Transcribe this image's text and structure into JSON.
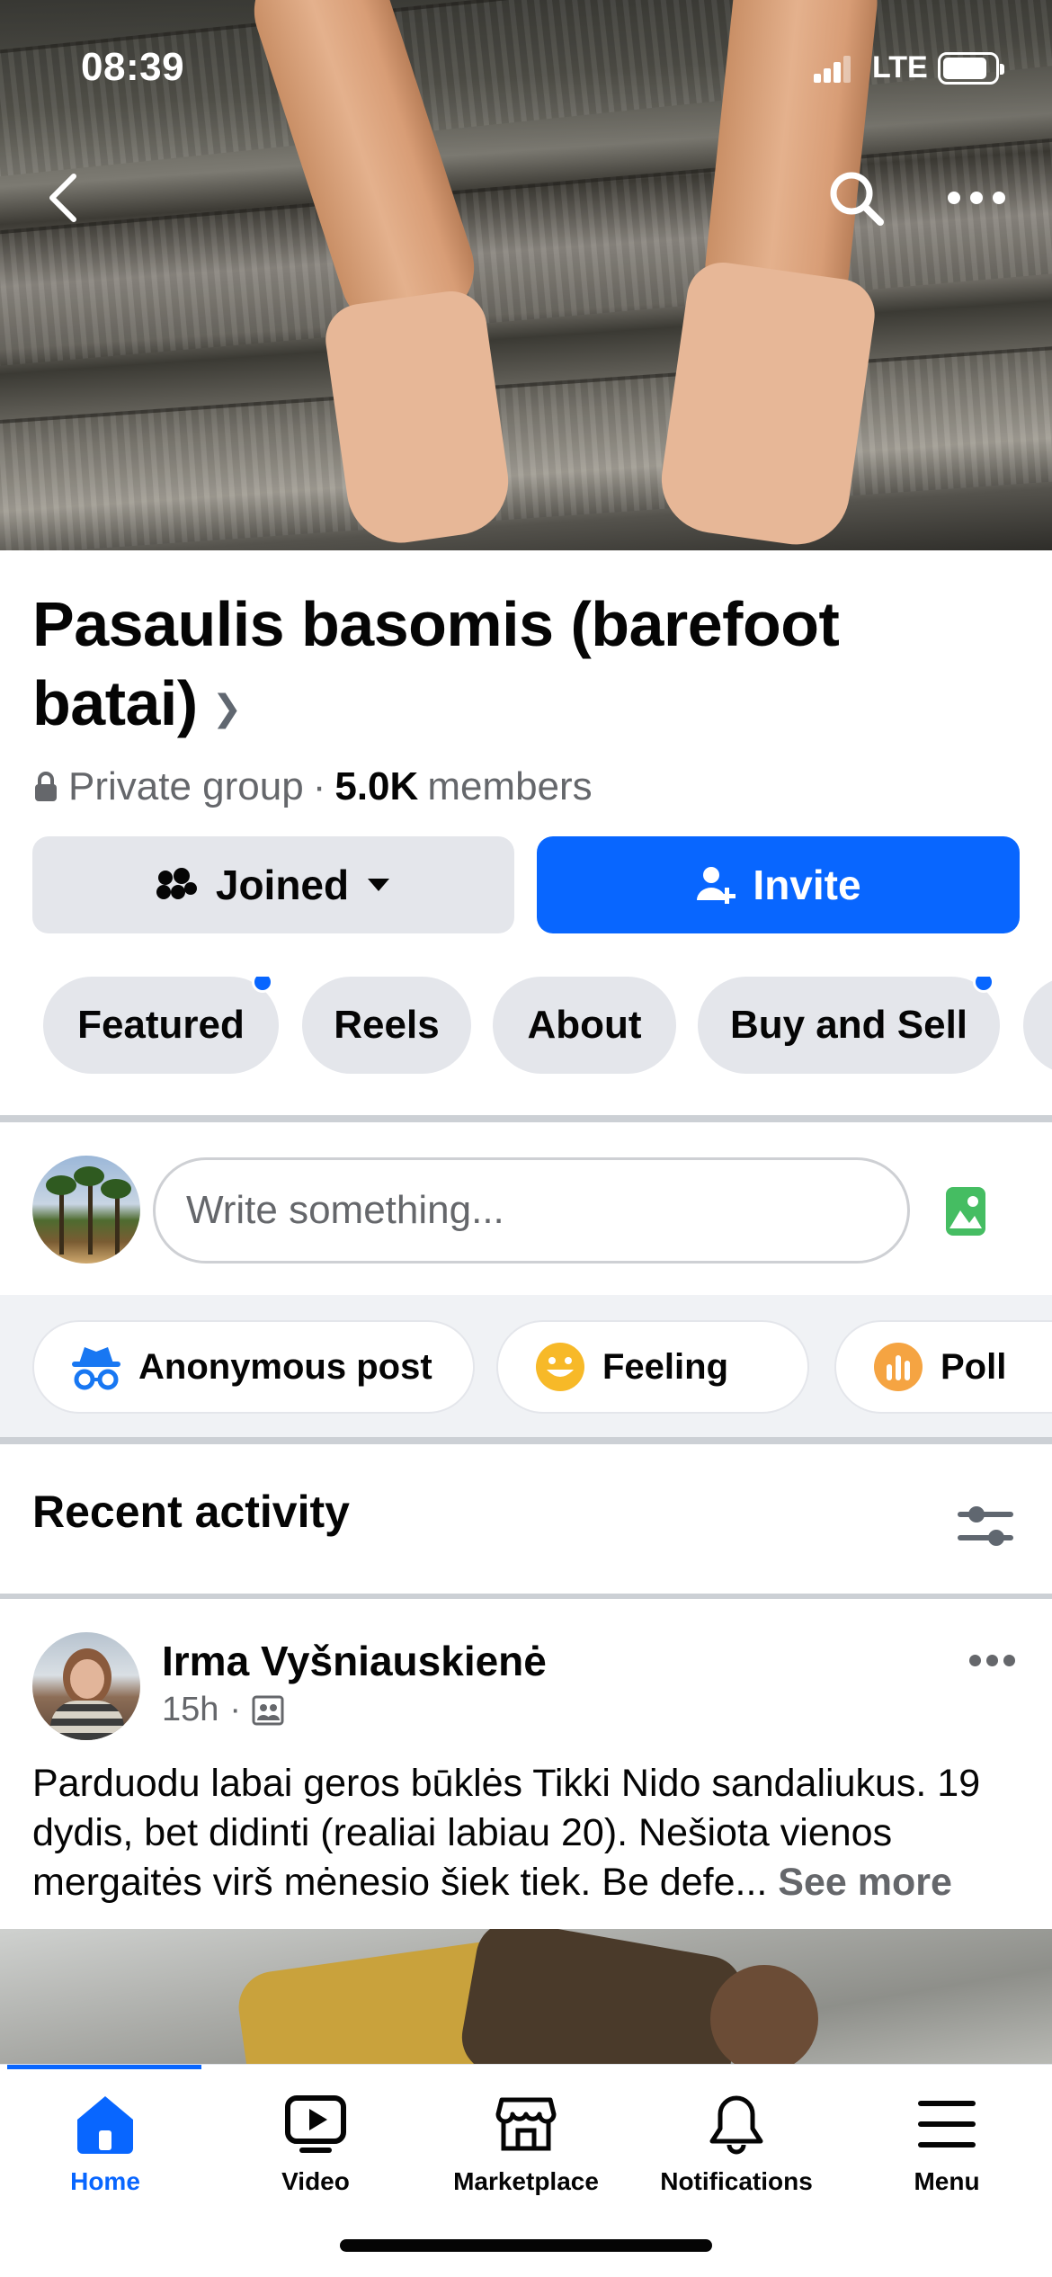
{
  "status_bar": {
    "time": "08:39",
    "network": "LTE"
  },
  "group": {
    "name": "Pasaulis basomis (barefoot batai)",
    "privacy": "Private group",
    "separator": "·",
    "members_count": "5.0K",
    "members_label": "members",
    "joined_label": "Joined",
    "invite_label": "Invite"
  },
  "tabs": [
    {
      "label": "Featured",
      "has_dot": true
    },
    {
      "label": "Reels",
      "has_dot": false
    },
    {
      "label": "About",
      "has_dot": false
    },
    {
      "label": "Buy and Sell",
      "has_dot": true
    }
  ],
  "composer": {
    "placeholder": "Write something..."
  },
  "quick_actions": [
    {
      "label": "Anonymous post",
      "icon": "incognito-icon"
    },
    {
      "label": "Feeling",
      "icon": "smiley-icon"
    },
    {
      "label": "Poll",
      "icon": "poll-icon"
    }
  ],
  "recent": {
    "title": "Recent activity"
  },
  "post": {
    "author": "Irma Vyšniauskienė",
    "time": "15h",
    "text": "Parduodu labai geros būklės Tikki Nido sandaliukus. 19 dydis, bet didinti (realiai labiau 20). Nešiota vienos mergaitės virš mėnesio šiek tiek. Be defe...",
    "see_more": "See more"
  },
  "nav": [
    {
      "label": "Home",
      "active": true
    },
    {
      "label": "Video",
      "active": false
    },
    {
      "label": "Marketplace",
      "active": false
    },
    {
      "label": "Notifications",
      "active": false
    },
    {
      "label": "Menu",
      "active": false
    }
  ],
  "colors": {
    "accent": "#0866ff",
    "chip_bg": "#e4e6eb",
    "muted_text": "#65676b"
  }
}
